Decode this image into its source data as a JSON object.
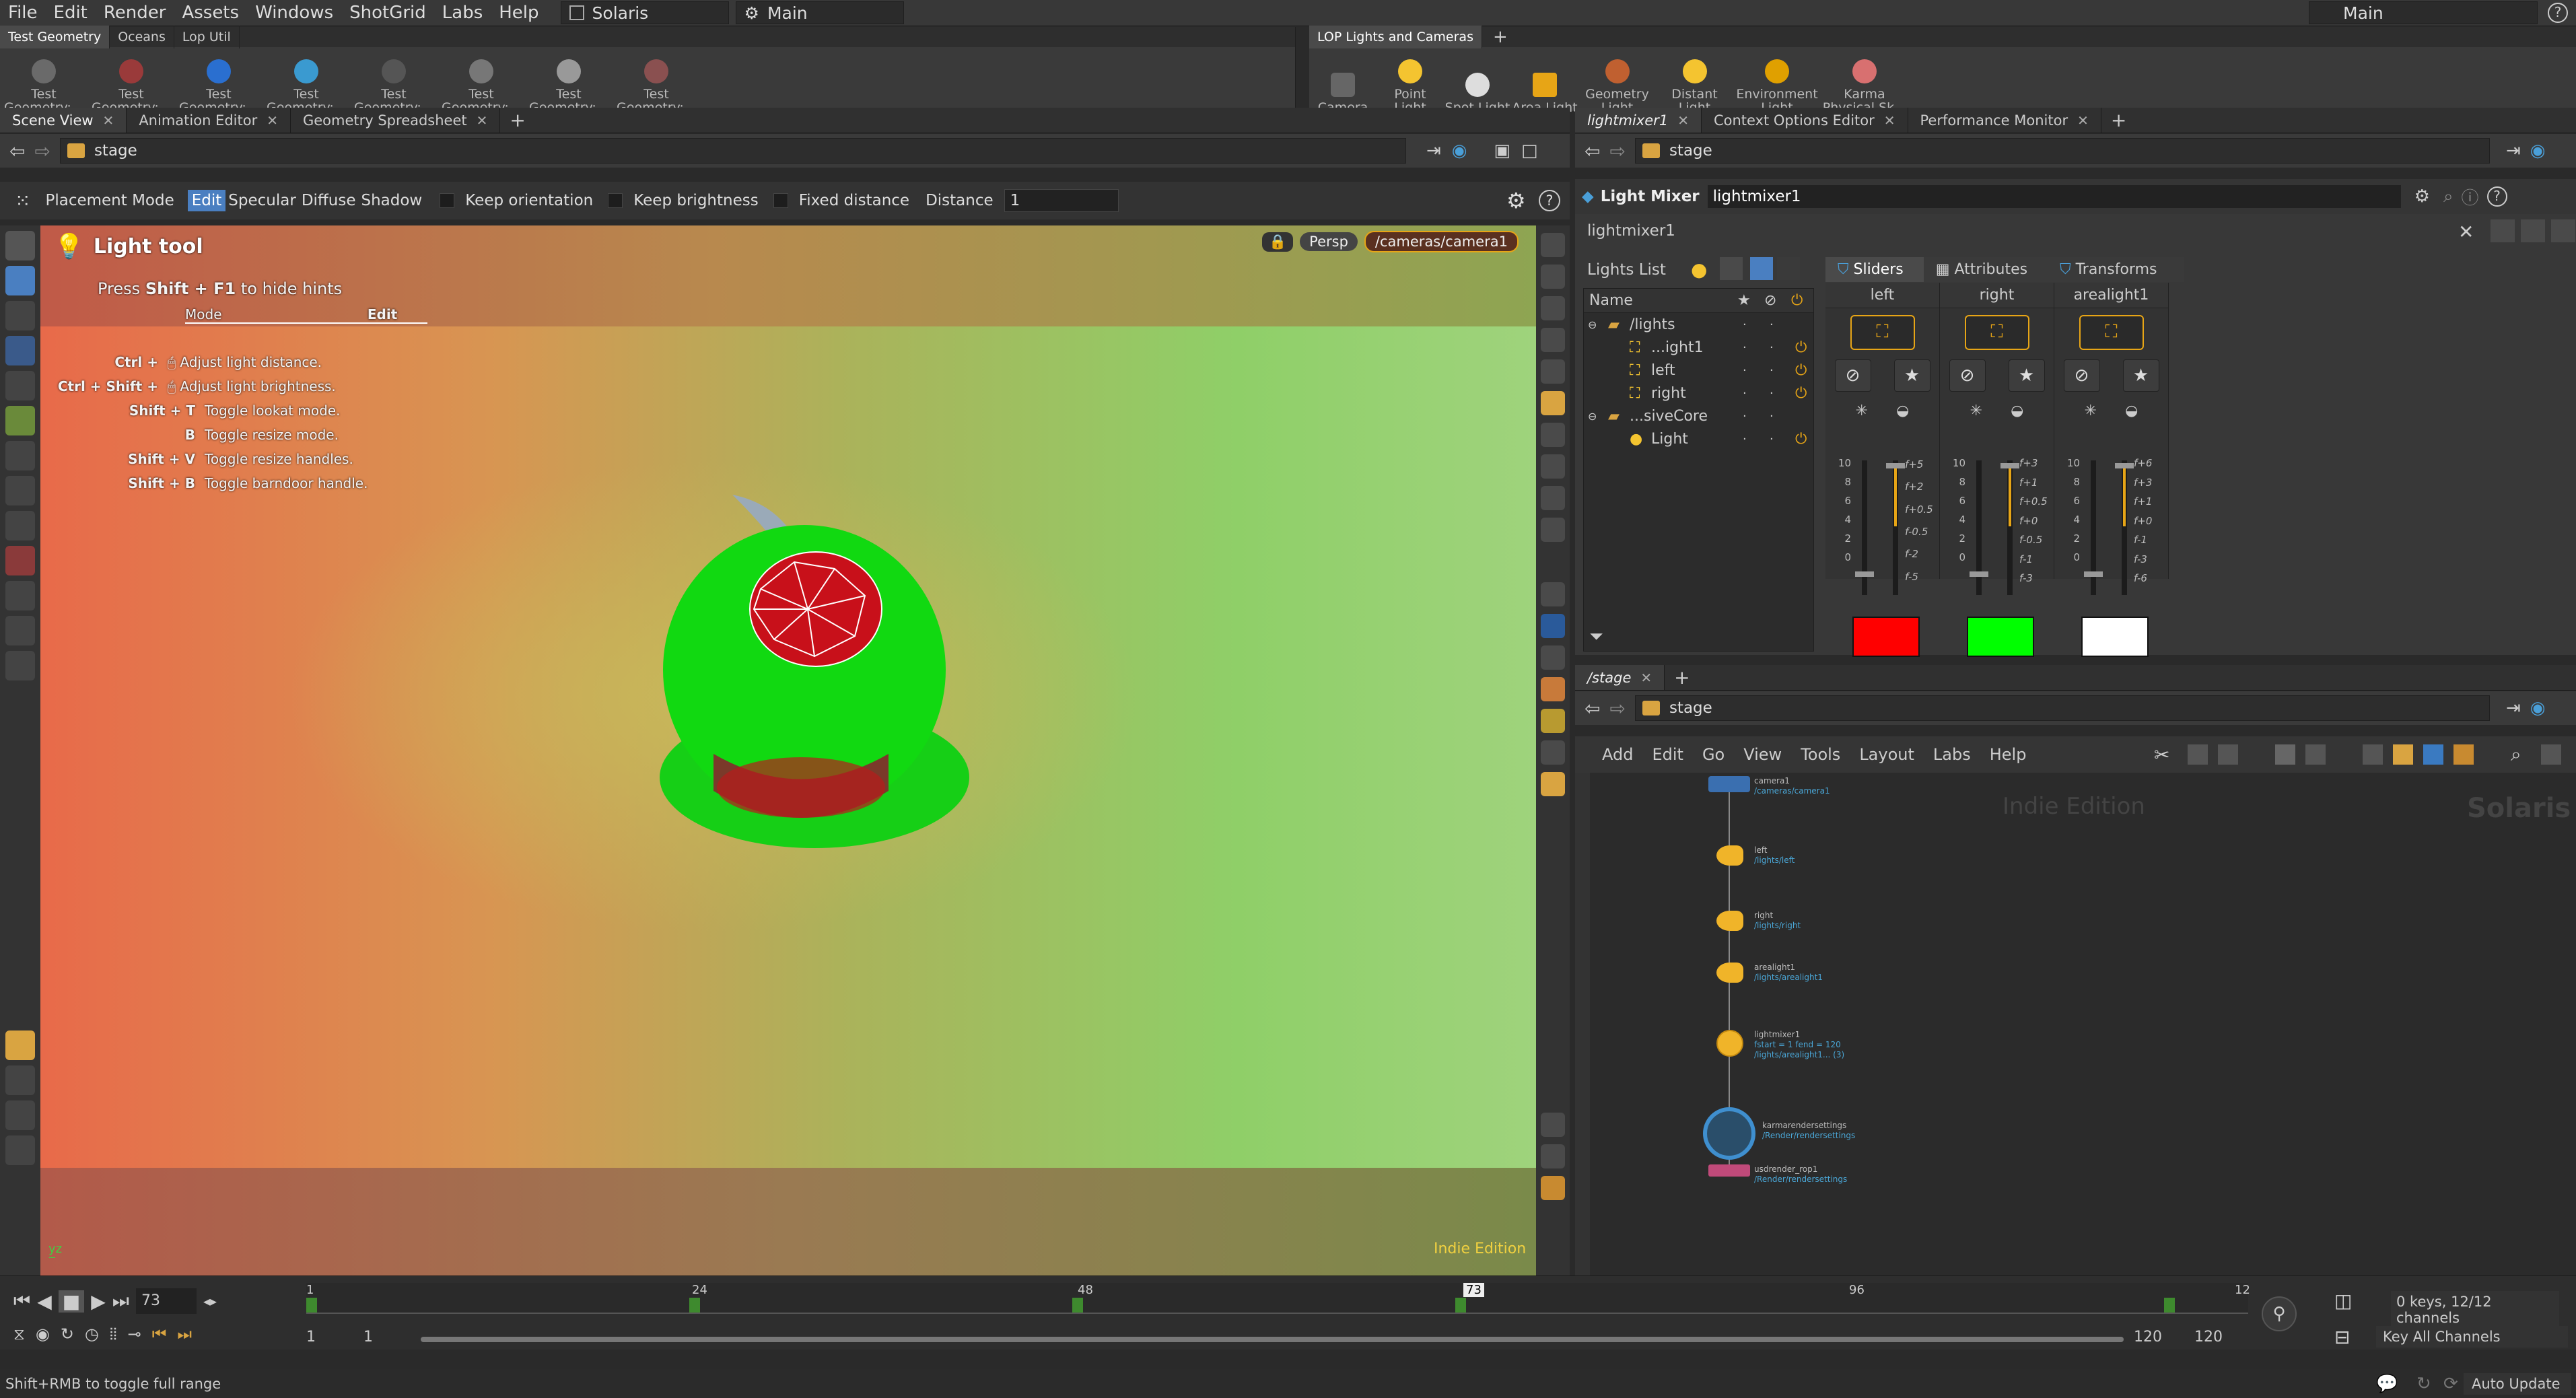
{
  "menu": {
    "items": [
      "File",
      "Edit",
      "Render",
      "Assets",
      "Windows",
      "ShotGrid",
      "Labs",
      "Help"
    ],
    "desktop": "Solaris",
    "context": "Main",
    "right_dropdown": "Main"
  },
  "shelf_left": {
    "tabs": [
      "Test Geometry",
      "Oceans",
      "Lop Util"
    ],
    "tools": [
      "Test Geometry:...",
      "Test Geometry:...",
      "Test Geometry:...",
      "Test Geometry:...",
      "Test Geometry:...",
      "Test Geometry:...",
      "Test Geometry:...",
      "Test Geometry:..."
    ]
  },
  "shelf_right": {
    "tabs": [
      "LOP Lights and Cameras"
    ],
    "tools": [
      "Camera",
      "Point Light",
      "Spot Light",
      "Area Light",
      "Geometry Light",
      "Distant Light",
      "Environment Light",
      "Karma Physical Sk..."
    ]
  },
  "left_pane": {
    "tabs": [
      "Scene View",
      "Animation Editor",
      "Geometry Spreadsheet"
    ],
    "path": "stage",
    "viewbar": {
      "placement_mode": "Placement Mode",
      "modes": [
        "Edit",
        "Specular",
        "Diffuse",
        "Shadow"
      ],
      "keep_orientation": "Keep orientation",
      "keep_brightness": "Keep brightness",
      "fixed_distance": "Fixed distance",
      "distance_label": "Distance",
      "distance_value": "1"
    },
    "viewport": {
      "tool_title": "Light tool",
      "hint_prefix": "Press",
      "hint_keys": "Shift + F1",
      "hint_suffix": "to hide hints",
      "hint_tab_mode": "Mode",
      "hint_tab_edit": "Edit",
      "shortcuts": [
        {
          "key": "Ctrl +",
          "desc": "Adjust light distance."
        },
        {
          "key": "Ctrl + Shift +",
          "desc": "Adjust light brightness."
        },
        {
          "key": "Shift + T",
          "desc": "Toggle lookat mode."
        },
        {
          "key": "B",
          "desc": "Toggle resize mode."
        },
        {
          "key": "Shift + V",
          "desc": "Toggle resize handles."
        },
        {
          "key": "Shift + B",
          "desc": "Toggle barndoor handle."
        }
      ],
      "persp": "Persp",
      "camera": "/cameras/camera1",
      "edition": "Indie Edition"
    }
  },
  "right_top": {
    "tabs": [
      "lightmixer1",
      "Context Options Editor",
      "Performance Monitor"
    ],
    "path": "stage",
    "node_type": "Light Mixer",
    "node_name": "lightmixer1",
    "node_label": "lightmixer1",
    "lights_list_label": "Lights List",
    "mixer_tabs": [
      "Sliders",
      "Attributes",
      "Transforms"
    ],
    "tree_header": "Name",
    "tree": [
      {
        "label": "/lights",
        "indent": 0,
        "type": "folder"
      },
      {
        "label": "...ight1",
        "indent": 1,
        "type": "light"
      },
      {
        "label": "left",
        "indent": 1,
        "type": "light"
      },
      {
        "label": "right",
        "indent": 1,
        "type": "light"
      },
      {
        "label": "...siveCore",
        "indent": 0,
        "type": "folder"
      },
      {
        "label": "Light",
        "indent": 1,
        "type": "bulb"
      }
    ],
    "columns": [
      {
        "name": "left",
        "color": "#ff0000",
        "fstops": [
          "f+5",
          "f+2",
          "f+0.5",
          "f-0.5",
          "f-2",
          "f-5"
        ]
      },
      {
        "name": "right",
        "color": "#00ff00",
        "fstops": [
          "f+3",
          "f+1",
          "f+0.5",
          "f+0",
          "f-0.5",
          "f-1",
          "f-3"
        ]
      },
      {
        "name": "arealight1",
        "color": "#ffffff",
        "fstops": [
          "f+6",
          "f+3",
          "f+1",
          "f+0",
          "f-1",
          "f-3",
          "f-6"
        ]
      }
    ],
    "scale_ticks": [
      "10",
      "8",
      "6",
      "4",
      "2",
      "0"
    ]
  },
  "network": {
    "tab": "/stage",
    "path": "stage",
    "menu": [
      "Add",
      "Edit",
      "Go",
      "View",
      "Tools",
      "Layout",
      "Labs",
      "Help"
    ],
    "watermark": "Indie Edition",
    "context_label": "Solaris",
    "nodes": [
      {
        "name": "camera1",
        "sub": "/cameras/camera1"
      },
      {
        "name": "left",
        "sub": "/lights/left"
      },
      {
        "name": "right",
        "sub": "/lights/right"
      },
      {
        "name": "arealight1",
        "sub": "/lights/arealight1"
      },
      {
        "name": "lightmixer1",
        "sub": "fstart = 1 fend = 120 /lights/arealight1... (3)"
      },
      {
        "name": "karmarendersettings",
        "sub": "/Render/rendersettings"
      },
      {
        "name": "usdrender_rop1",
        "sub": "/Render/rendersettings"
      }
    ]
  },
  "timeline": {
    "frame": "73",
    "ticks": [
      "1",
      "24",
      "48",
      "73",
      "96",
      "12"
    ],
    "start": "1",
    "start2": "1",
    "end": "120",
    "end2": "120",
    "keys_info": "0 keys, 12/12 channels",
    "key_all": "Key All Channels",
    "auto_update": "Auto Update"
  },
  "status": {
    "text": "Shift+RMB to toggle full range"
  },
  "colors": {
    "accent": "#e7a516",
    "select": "#4a7fc1",
    "net_link": "#4aa6d6"
  }
}
